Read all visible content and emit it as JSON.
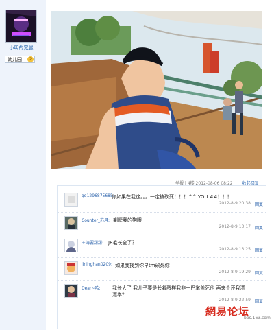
{
  "sidebar": {
    "username": "小明的宽腿",
    "rank": "幼儿园",
    "rank_badge": "2"
  },
  "post": {
    "meta": "举报 | 4楼 2012-08-06 08:22",
    "collapse": "收起回复"
  },
  "comments": [
    {
      "user": "qq1296875685:",
      "text": "你如果在我这。。。一定被砍死！！！^^ YOU ##！！！",
      "time": "2012-8-9 20:38",
      "reply": "回复"
    },
    {
      "user": "Counter_苏月:",
      "text": "剃睫我的狗眼",
      "time": "2012-8-9 13:17",
      "reply": "回复"
    },
    {
      "user": "王涛要甜甜:",
      "text": "J8毛长全了？",
      "time": "2012-8-9 13:25",
      "reply": "回复"
    },
    {
      "user": "lininghan0209:",
      "text": "如果我找到你早tm砍死你",
      "time": "2012-8-9 19:29",
      "reply": "回复"
    },
    {
      "user": "Dear~哈:",
      "text": "我长大了 我儿子要是长着醒样我非一巴掌盖死他 再来个还我漂漂拳？",
      "time": "2012-8-9 22:59",
      "reply": "回复"
    }
  ],
  "watermark": {
    "brand_a": "網易",
    "brand_b": "论坛",
    "domain": "bbs.163.com"
  },
  "colors": {
    "link": "#2860aa",
    "sidebar_bg": "#eef3fb",
    "watermark": "#d72c1f"
  }
}
